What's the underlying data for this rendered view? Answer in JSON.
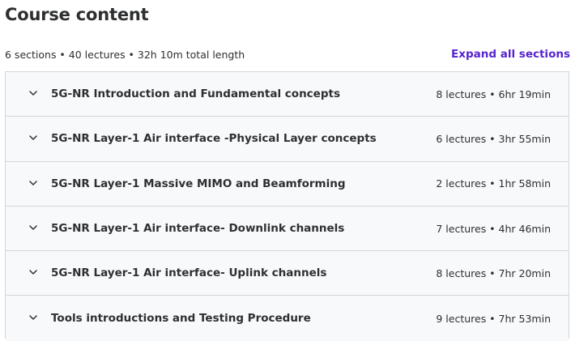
{
  "header": {
    "title": "Course content"
  },
  "summary": {
    "text": "6 sections • 40 lectures • 32h 10m total length",
    "expand_label": "Expand all sections"
  },
  "sections": [
    {
      "title": "5G-NR Introduction and Fundamental concepts",
      "meta": "8 lectures • 6hr 19min"
    },
    {
      "title": "5G-NR Layer-1 Air interface -Physical Layer concepts",
      "meta": "6 lectures • 3hr 55min"
    },
    {
      "title": "5G-NR Layer-1 Massive MIMO and Beamforming",
      "meta": "2 lectures • 1hr 58min"
    },
    {
      "title": "5G-NR Layer-1 Air interface- Downlink channels",
      "meta": "7 lectures • 4hr 46min"
    },
    {
      "title": "5G-NR Layer-1 Air interface- Uplink channels",
      "meta": "8 lectures • 7hr 20min"
    },
    {
      "title": "Tools introductions and Testing Procedure",
      "meta": "9 lectures • 7hr 53min"
    }
  ],
  "icons": {
    "section_toggle": "chevron-down-icon"
  },
  "colors": {
    "accent": "#5624d0",
    "text": "#2d2f31",
    "row_background": "#f7f9fa",
    "border": "#d1d7dc"
  }
}
